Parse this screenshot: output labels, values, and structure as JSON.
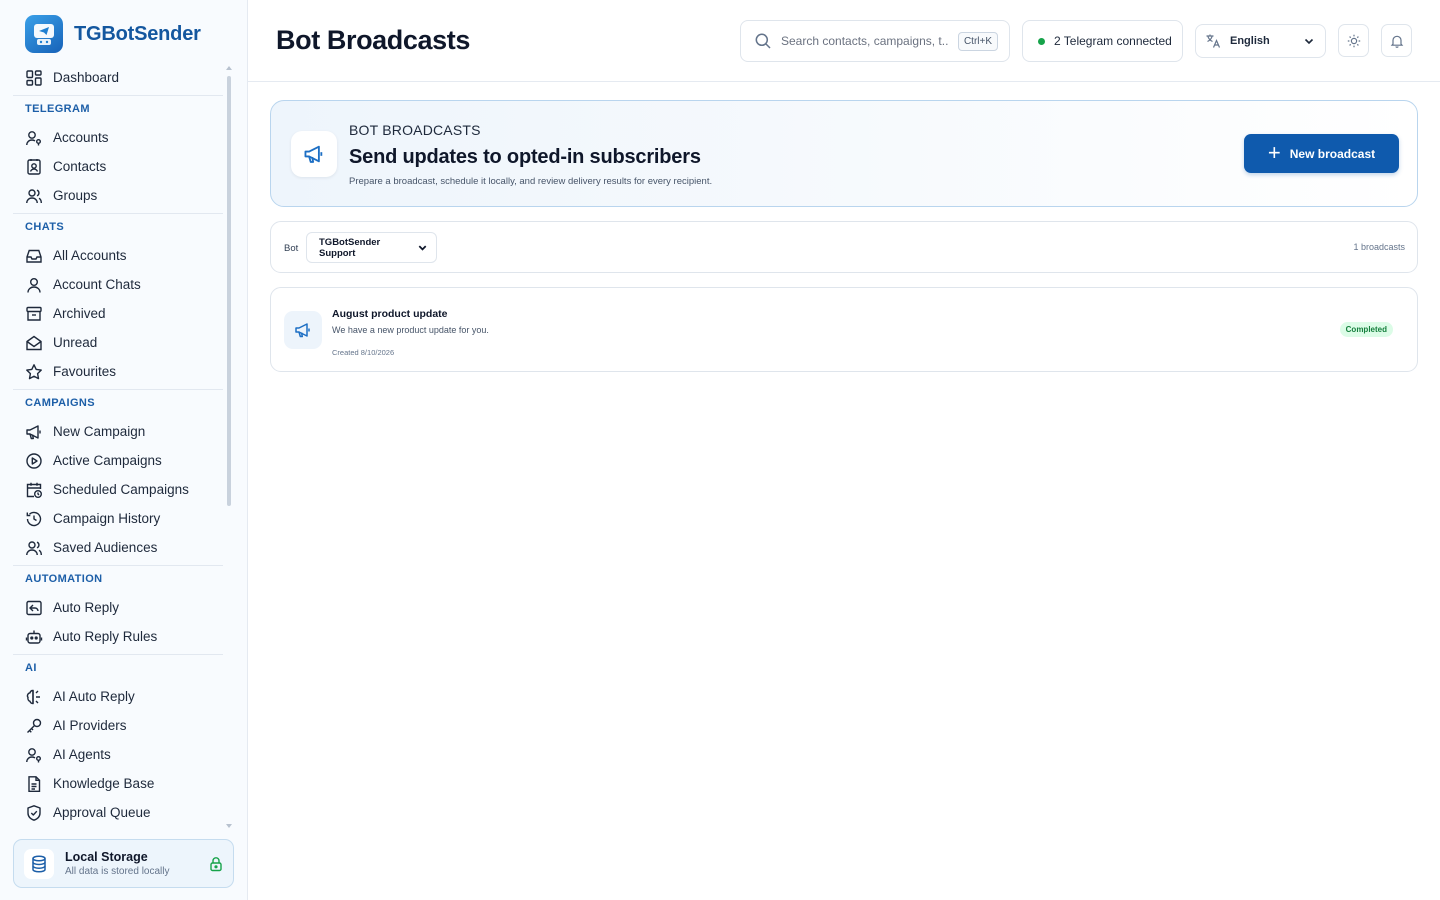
{
  "brand": {
    "name": "TGBotSender"
  },
  "nav": {
    "dashboard": "Dashboard",
    "sections": [
      {
        "title": "TELEGRAM",
        "items": [
          {
            "label": "Accounts",
            "icon": "user-key-icon"
          },
          {
            "label": "Contacts",
            "icon": "contact-book-icon"
          },
          {
            "label": "Groups",
            "icon": "users-icon"
          }
        ]
      },
      {
        "title": "CHATS",
        "items": [
          {
            "label": "All Accounts",
            "icon": "inbox-icon"
          },
          {
            "label": "Account Chats",
            "icon": "user-icon"
          },
          {
            "label": "Archived",
            "icon": "archive-icon"
          },
          {
            "label": "Unread",
            "icon": "envelope-open-icon"
          },
          {
            "label": "Favourites",
            "icon": "star-icon"
          }
        ]
      },
      {
        "title": "CAMPAIGNS",
        "items": [
          {
            "label": "New Campaign",
            "icon": "megaphone-icon"
          },
          {
            "label": "Active Campaigns",
            "icon": "play-circle-icon"
          },
          {
            "label": "Scheduled Campaigns",
            "icon": "calendar-clock-icon"
          },
          {
            "label": "Campaign History",
            "icon": "history-icon"
          },
          {
            "label": "Saved Audiences",
            "icon": "users-icon"
          }
        ]
      },
      {
        "title": "AUTOMATION",
        "items": [
          {
            "label": "Auto Reply",
            "icon": "reply-square-icon"
          },
          {
            "label": "Auto Reply Rules",
            "icon": "bot-icon"
          }
        ]
      },
      {
        "title": "AI",
        "items": [
          {
            "label": "AI Auto Reply",
            "icon": "brain-icon"
          },
          {
            "label": "AI Providers",
            "icon": "key-icon"
          },
          {
            "label": "AI Agents",
            "icon": "user-key-icon"
          },
          {
            "label": "Knowledge Base",
            "icon": "document-icon"
          },
          {
            "label": "Approval Queue",
            "icon": "shield-check-icon"
          }
        ]
      }
    ]
  },
  "storage": {
    "title": "Local Storage",
    "subtitle": "All data is stored locally"
  },
  "header": {
    "title": "Bot Broadcasts",
    "search_placeholder": "Search contacts, campaigns, t...",
    "search_shortcut": "Ctrl+K",
    "connection_status": "2 Telegram connected",
    "language": "English"
  },
  "hero": {
    "eyebrow": "BOT BROADCASTS",
    "title": "Send updates to opted-in subscribers",
    "description": "Prepare a broadcast, schedule it locally, and review delivery results for every recipient.",
    "button_label": "New broadcast"
  },
  "filter": {
    "bot_label": "Bot",
    "bot_selected": "TGBotSender Support",
    "count": "1 broadcasts"
  },
  "broadcasts": [
    {
      "title": "August product update",
      "message": "We have a new product update for you.",
      "created": "Created 8/10/2026",
      "status": "Completed"
    }
  ],
  "colors": {
    "accent": "#0f5aad",
    "brand_text": "#14579f",
    "section_title": "#1d5fa8",
    "status_green": "#16a34a"
  }
}
